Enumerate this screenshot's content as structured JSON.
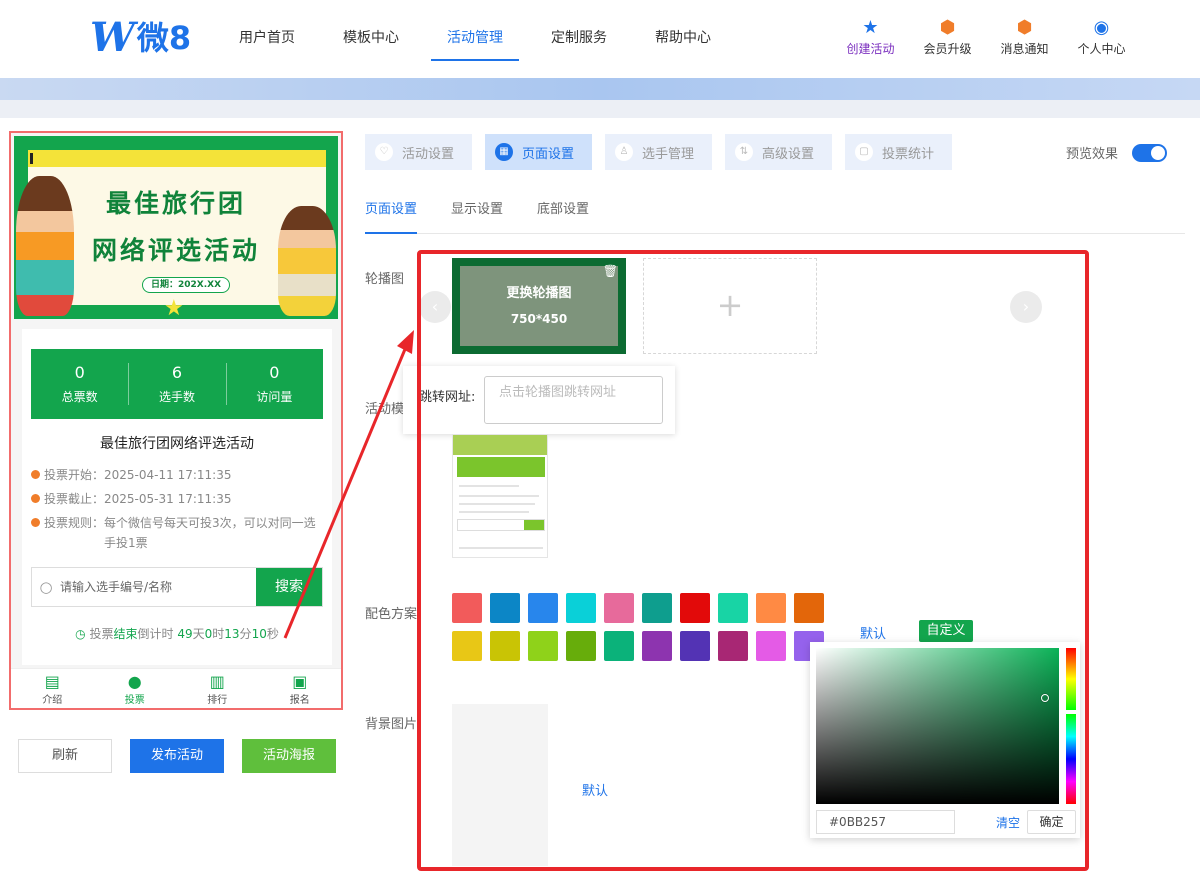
{
  "header": {
    "logo_mark": "W",
    "logo_text": "微8",
    "nav": [
      {
        "label": "用户首页"
      },
      {
        "label": "模板中心"
      },
      {
        "label": "活动管理",
        "active": true
      },
      {
        "label": "定制服务"
      },
      {
        "label": "帮助中心"
      }
    ],
    "tools": [
      {
        "label": "创建活动",
        "icon": "star-icon"
      },
      {
        "label": "会员升级",
        "icon": "crown-badge-icon"
      },
      {
        "label": "消息通知",
        "icon": "bell-badge-icon"
      },
      {
        "label": "个人中心",
        "icon": "user-icon"
      }
    ]
  },
  "preview": {
    "poster_title_1": "最佳旅行团",
    "poster_title_2": "网络评选活动",
    "poster_date": "日期：202X.XX",
    "stats": [
      {
        "value": "0",
        "label": "总票数"
      },
      {
        "value": "6",
        "label": "选手数"
      },
      {
        "value": "0",
        "label": "访问量"
      }
    ],
    "activity_title": "最佳旅行团网络评选活动",
    "vote_start_label": "投票开始：",
    "vote_start": "2025-04-11 17:11:35",
    "vote_end_label": "投票截止：",
    "vote_end": "2025-05-31 17:11:35",
    "vote_rule_label": "投票规则：",
    "vote_rule": "每个微信号每天可投3次，可以对同一选手投1票",
    "search_placeholder": "请输入选手编号/名称",
    "search_button": "搜索",
    "countdown": {
      "prefix": "投票",
      "status": "结束",
      "text": "倒计时",
      "days": "49",
      "days_unit": "天",
      "hours": "0",
      "hours_unit": "时",
      "minutes": "13",
      "minutes_unit": "分",
      "seconds": "10",
      "seconds_unit": "秒"
    },
    "tabbar": [
      {
        "label": "介绍",
        "icon": "intro-icon"
      },
      {
        "label": "投票",
        "icon": "user-icon",
        "active": true
      },
      {
        "label": "排行",
        "icon": "bar-chart-icon"
      },
      {
        "label": "报名",
        "icon": "signup-icon"
      }
    ]
  },
  "actions": {
    "refresh": "刷新",
    "publish": "发布活动",
    "poster": "活动海报"
  },
  "settings": {
    "steps": [
      {
        "label": "活动设置",
        "icon": "heart-icon"
      },
      {
        "label": "页面设置",
        "icon": "grid-icon",
        "active": true
      },
      {
        "label": "选手管理",
        "icon": "user-icon"
      },
      {
        "label": "高级设置",
        "icon": "sliders-icon"
      },
      {
        "label": "投票统计",
        "icon": "calendar-icon"
      }
    ],
    "preview_label": "预览效果",
    "subtabs": [
      {
        "label": "页面设置",
        "active": true
      },
      {
        "label": "显示设置"
      },
      {
        "label": "底部设置"
      }
    ],
    "carousel_label": "轮播图",
    "slide_change": "更换轮播图",
    "slide_size": "750*450",
    "link_label": "跳转网址:",
    "link_placeholder": "点击轮播图跳转网址",
    "template_label": "活动模",
    "color_label": "配色方案",
    "colors": [
      "#F25B5B",
      "#0C86C6",
      "#2886EC",
      "#0AD0D8",
      "#E76A9B",
      "#0E9E8E",
      "#E20A0A",
      "#18D4A5",
      "#FF8A44",
      "#E3660A",
      "#E8C716",
      "#C9C405",
      "#8FD21A",
      "#67AD0B",
      "#0BB27A",
      "#8D34AF",
      "#5333B4",
      "#A82774",
      "#E45BE6",
      "#9562EC"
    ],
    "default_label": "默认",
    "custom_label": "自定义",
    "hex_value": "#0BB257",
    "clear_label": "清空",
    "confirm_label": "确定",
    "bg_label": "背景图片",
    "bg_default": "默认"
  }
}
